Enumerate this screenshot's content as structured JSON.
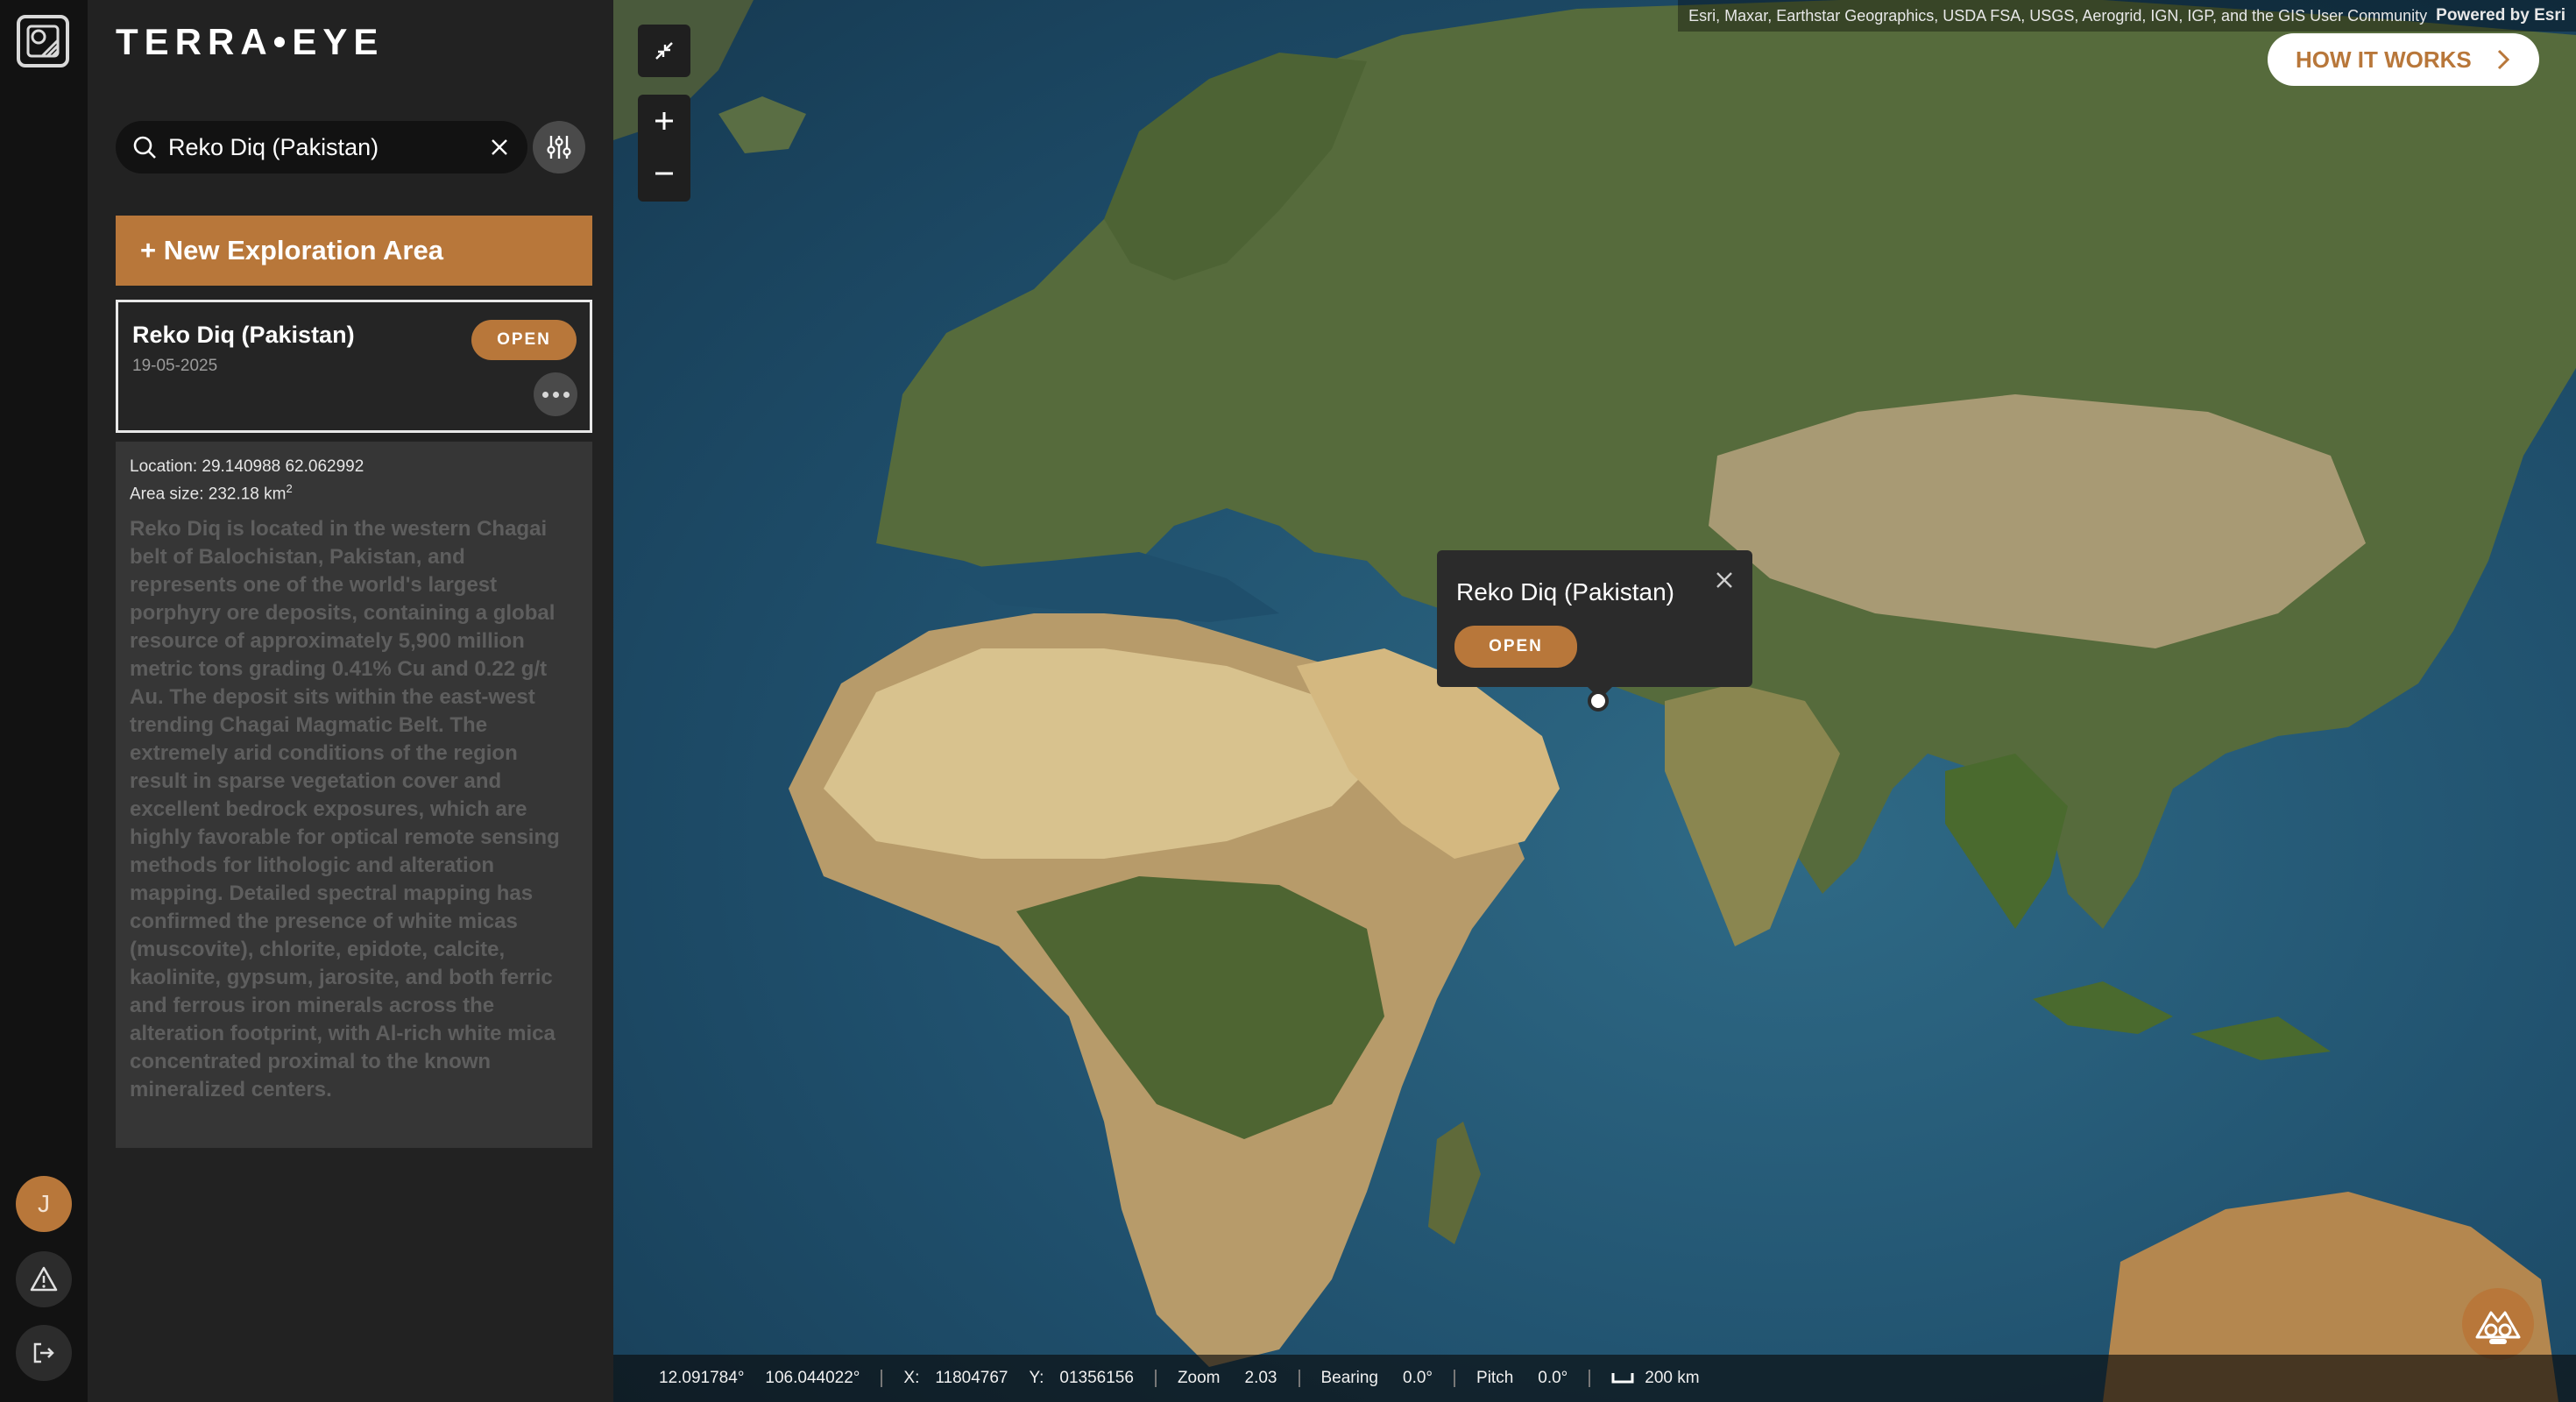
{
  "app": {
    "brand": "TERRA•EYE"
  },
  "search": {
    "value": "Reko Diq (Pakistan)",
    "placeholder": ""
  },
  "panel": {
    "new_area_label": "+ New Exploration Area",
    "card": {
      "title": "Reko Diq (Pakistan)",
      "date": "19-05-2025",
      "open_label": "OPEN"
    },
    "details": {
      "location": "Location: 29.140988 62.062992",
      "area_size_prefix": "Area size: 232.18 km",
      "area_size_sup": "2",
      "description": "Reko Diq is located in the western Chagai belt of Balochistan, Pakistan, and represents one of the world's largest porphyry ore deposits, containing a global resource of approximately 5,900 million metric tons grading 0.41% Cu and 0.22 g/t Au. The deposit sits within the east-west trending Chagai Magmatic Belt. The extremely arid conditions of the region result in sparse vegetation cover and excellent bedrock exposures, which are highly favorable for optical remote sensing methods for lithologic and alteration mapping. Detailed spectral mapping has confirmed the presence of white micas (muscovite), chlorite, epidote, calcite, kaolinite, gypsum, jarosite, and both ferric and ferrous iron minerals across the alteration footprint, with Al-rich white mica concentrated proximal to the known mineralized centers."
    }
  },
  "rail": {
    "avatar_initial": "J"
  },
  "map": {
    "attribution": "Esri, Maxar, Earthstar Geographics, USDA FSA, USGS, Aerogrid, IGN, IGP, and the GIS User Community",
    "powered_by": "Powered by Esri",
    "how_it_works": "HOW IT WORKS",
    "popup": {
      "title": "Reko Diq (Pakistan)",
      "open_label": "OPEN"
    },
    "status": {
      "lat": "12.091784°",
      "lon": "106.044022°",
      "x_label": "X:",
      "x_value": "11804767",
      "y_label": "Y:",
      "y_value": "01356156",
      "zoom_label": "Zoom",
      "zoom_value": "2.03",
      "bearing_label": "Bearing",
      "bearing_value": "0.0°",
      "pitch_label": "Pitch",
      "pitch_value": "0.0°",
      "scale": "200 km"
    }
  },
  "colors": {
    "accent": "#b8773a",
    "panel": "#222222",
    "rail": "#121212"
  }
}
